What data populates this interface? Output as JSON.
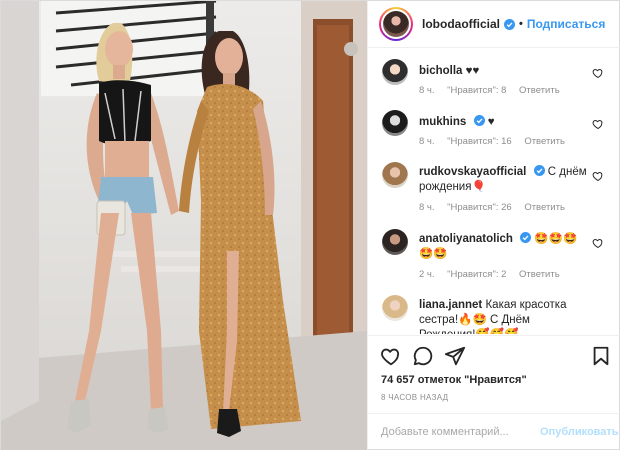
{
  "header": {
    "username": "lobodaofficial",
    "separator": "•",
    "follow_label": "Подписаться"
  },
  "comments": [
    {
      "username": "bicholla",
      "text": "♥♥",
      "time": "8 ч.",
      "likes": "\"Нравится\": 8",
      "reply": "Ответить"
    },
    {
      "username": "mukhins",
      "text": "♥",
      "time": "8 ч.",
      "likes": "\"Нравится\": 16",
      "reply": "Ответить"
    },
    {
      "username": "rudkovskayaofficial",
      "text": "С днём рождения🎈",
      "time": "8 ч.",
      "likes": "\"Нравится\": 26",
      "reply": "Ответить"
    },
    {
      "username": "anatoliyanatolich",
      "text": "🤩🤩🤩🤩🤩",
      "time": "2 ч.",
      "likes": "\"Нравится\": 2",
      "reply": "Ответить"
    },
    {
      "username": "liana.jannet",
      "text": "Какая красотка сестра!🔥🤩 С Днём Рождения!🥰🥰🥰",
      "time": "",
      "likes": "",
      "reply": ""
    }
  ],
  "footer": {
    "likes_count": "74 657 отметок \"Нравится\"",
    "time_ago": "8 ЧАСОВ НАЗАД",
    "comment_placeholder": "Добавьте комментарий...",
    "publish_label": "Опубликовать"
  },
  "icons": {
    "like": "heart-outline-icon",
    "comment": "comment-bubble-icon",
    "share": "paper-plane-icon",
    "save": "bookmark-icon",
    "verified": "verified-badge-icon"
  },
  "colors": {
    "accent": "#3897f0",
    "text": "#262626",
    "muted": "#8e8e8e",
    "divider": "#efefef"
  }
}
